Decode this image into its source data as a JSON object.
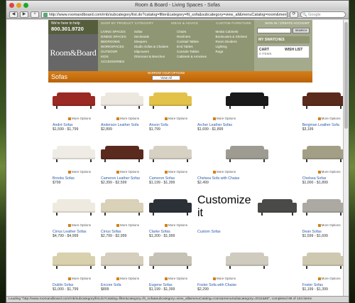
{
  "window": {
    "title": "Room & Board - Living Spaces - Sofas"
  },
  "toolbar": {
    "url": "http://www.roomandboard.com/rnb/subcategory/list.do?catalog=filter&category=fit_sofa&subcategory=view_all&menuCatalog=room&menuSub",
    "search_placeholder": "Google",
    "back": "◀",
    "forward": "▶",
    "plus": "+",
    "reload": "⟳"
  },
  "header": {
    "help_label": "We're here to help",
    "phone": "800.301.9720",
    "logo": "Room&Board",
    "shop_by": "SHOP BY PRODUCT CATEGORY",
    "ideas": "IDEAS & ADVICE",
    "custom_furniture": "CUSTOM FURNITURE",
    "sign_in": "SIGN IN / CREATE ACCOUNT",
    "search_button": "SEARCH",
    "my_swatches": "MY SWATCHES",
    "cart_label": "CART",
    "cart_count": "0 ITEMS",
    "wish_list": "WISH LIST",
    "rooms": [
      "LIVING SPACES",
      "DINING SPACES",
      "BEDROOMS",
      "WORKSPACES",
      "OUTDOOR",
      "KIDS",
      "ACCESSORIES"
    ],
    "col1": [
      "Sofas",
      "Sectionals",
      "Sleepers",
      "Studio Sofas & Chaises",
      "Slipcovers",
      "Ottomans & Benches"
    ],
    "col2": [
      "Chairs",
      "Recliners",
      "Cocktail Tables",
      "End Tables",
      "Console Tables",
      "Cabinets & Armoires"
    ],
    "col3": [
      "Media Cabinets",
      "Bookcases & Shelves",
      "Room Dividers",
      "Lighting",
      "Rugs"
    ]
  },
  "page": {
    "title": "Sofas",
    "narrow_label": "NARROW YOUR OPTIONS",
    "filter_value": "View All",
    "more_options": "More Options",
    "customize": "Customize it",
    "products": [
      {
        "name": "André Sofas",
        "price": "$1,599 - $1,799",
        "color": "#9a2a23"
      },
      {
        "name": "Anderson Leather Sofa",
        "price": "$2,899",
        "color": "#ece8df"
      },
      {
        "name": "Anson Sofa",
        "price": "$1,799",
        "color": "#e3c24a"
      },
      {
        "name": "Archer Leather Sofas",
        "price": "$1,699 - $1,899",
        "color": "#1a1a1a"
      },
      {
        "name": "Bergman Leather Sofa",
        "price": "$3,199",
        "color": "#5a2a1c"
      },
      {
        "name": "Brooks Sofas",
        "price": "$799",
        "color": "#efece6"
      },
      {
        "name": "Cameron Leather Sofas",
        "price": "$2,399 - $2,599",
        "color": "#5b2a1e"
      },
      {
        "name": "Cameron Sofas",
        "price": "$1,199 - $1,399",
        "color": "#d7d1c3"
      },
      {
        "name": "Chelsea Sofa with Chaise",
        "price": "$2,499",
        "color": "#9e9c92"
      },
      {
        "name": "Chelsea Sofas",
        "price": "$1,000 - $1,899",
        "color": "#a39f86"
      },
      {
        "name": "Cirrus Leather Sofas",
        "price": "$4,799 - $4,999",
        "color": "#efeae0"
      },
      {
        "name": "Cirrus Sofas",
        "price": "$2,799 - $2,999",
        "color": "#d9d1b8"
      },
      {
        "name": "Clarke Sofas",
        "price": "$1,200 - $1,999",
        "color": "#2c3138"
      },
      {
        "name": "Custom Sofas",
        "price": "",
        "color": "#4a4a48",
        "custom": true
      },
      {
        "name": "Dean Sofas",
        "price": "$1,599 - $1,699",
        "color": "#aba9a2"
      },
      {
        "name": "Dublin Sofas",
        "price": "$1,000 - $1,799",
        "color": "#d9d0ae"
      },
      {
        "name": "Encore Sofa",
        "price": "$899",
        "color": "#d6cfbd"
      },
      {
        "name": "Eugene Sofas",
        "price": "$1,199 - $1,399",
        "color": "#c7c2b6"
      },
      {
        "name": "Foster Sofa with Chaise",
        "price": "$2,299",
        "color": "#cfcbbf"
      },
      {
        "name": "Foster Sofas",
        "price": "$1,199 - $1,399",
        "color": "#cfc8b1"
      }
    ]
  },
  "status": "Loading \"http://www.roomandboard.com/rnb/subcategory/list.do?catalog=filter&category=fit_sofa&subcategory=view_all&menuCatalog=room&menuSub&category=2011&80\", completed 98 of 104 items",
  "colors": {
    "accent": "#d67f1a",
    "brand": "#555d3c",
    "link": "#2a5aa8"
  }
}
